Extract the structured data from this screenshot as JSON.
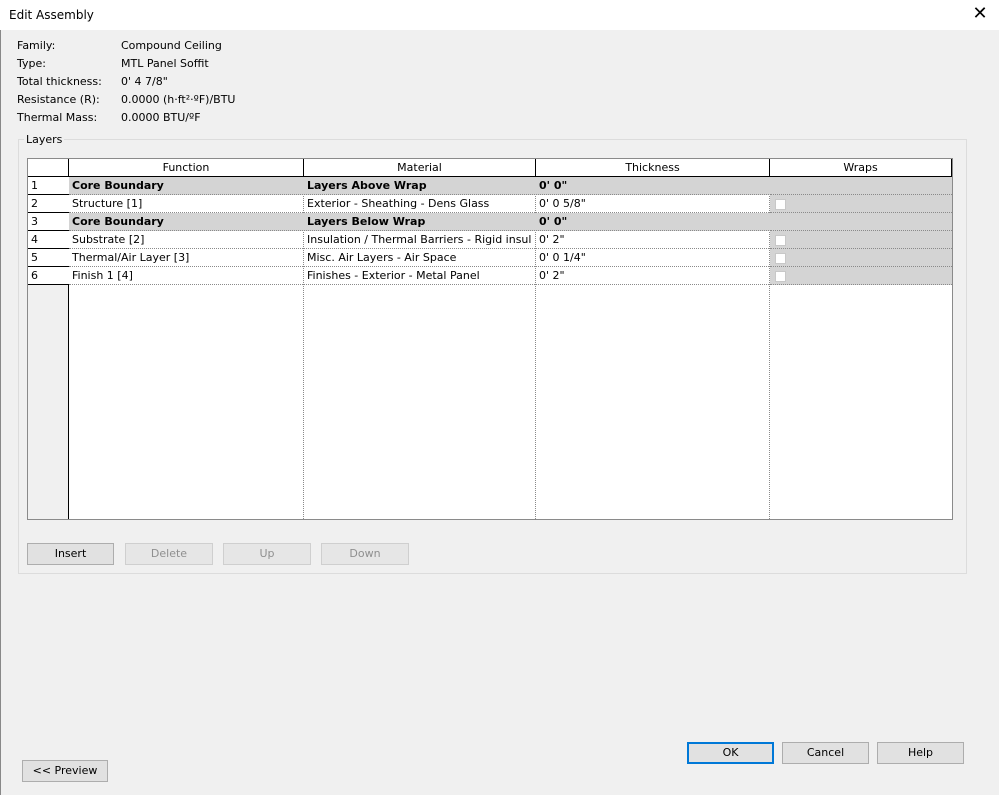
{
  "window": {
    "title": "Edit Assembly",
    "close_glyph": "✕"
  },
  "properties": [
    {
      "label": "Family:",
      "value": "Compound Ceiling"
    },
    {
      "label": "Type:",
      "value": "MTL Panel Soffit"
    },
    {
      "label": "Total thickness:",
      "value": "0'  4 7/8\""
    },
    {
      "label": "Resistance (R):",
      "value": "0.0000 (h·ft²·ºF)/BTU"
    },
    {
      "label": "Thermal Mass:",
      "value": "0.0000 BTU/ºF"
    }
  ],
  "layers": {
    "legend": "Layers",
    "columns": [
      "Function",
      "Material",
      "Thickness",
      "Wraps"
    ],
    "rows": [
      {
        "num": "1",
        "function": "Core Boundary",
        "material": "Layers Above Wrap",
        "thickness": "0'  0\"",
        "core": true,
        "wraps": null
      },
      {
        "num": "2",
        "function": "Structure [1]",
        "material": "Exterior - Sheathing - Dens Glass",
        "thickness": "0'  0 5/8\"",
        "core": false,
        "wraps": false
      },
      {
        "num": "3",
        "function": "Core Boundary",
        "material": "Layers Below Wrap",
        "thickness": "0'  0\"",
        "core": true,
        "wraps": null
      },
      {
        "num": "4",
        "function": "Substrate [2]",
        "material": "Insulation / Thermal Barriers - Rigid insul",
        "thickness": "0'  2\"",
        "core": false,
        "wraps": false
      },
      {
        "num": "5",
        "function": "Thermal/Air Layer [3]",
        "material": "Misc. Air Layers - Air Space",
        "thickness": "0'  0 1/4\"",
        "core": false,
        "wraps": false
      },
      {
        "num": "6",
        "function": "Finish 1 [4]",
        "material": "Finishes - Exterior - Metal Panel",
        "thickness": "0'  2\"",
        "core": false,
        "wraps": false
      }
    ]
  },
  "layer_buttons": {
    "insert": "Insert",
    "delete": "Delete",
    "up": "Up",
    "down": "Down"
  },
  "dialog_buttons": {
    "ok": "OK",
    "cancel": "Cancel",
    "help": "Help",
    "preview": "<< Preview"
  }
}
